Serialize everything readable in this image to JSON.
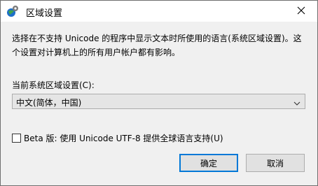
{
  "window": {
    "title": "区域设置",
    "icon": "globe-gear-icon",
    "close_icon": "close-icon"
  },
  "content": {
    "description": "选择在不支持 Unicode 的程序中显示文本时所使用的语言(系统区域设置)。这个设置对计算机上的所有用户帐户都有影响。",
    "select_label": "当前系统区域设置(C):",
    "select_value": "中文(简体，中国)",
    "checkbox_label": "Beta 版: 使用 Unicode UTF-8 提供全球语言支持(U)",
    "checkbox_checked": false
  },
  "buttons": {
    "ok": "确定",
    "cancel": "取消"
  },
  "colors": {
    "accent": "#0078d7",
    "dialog_bg": "#f0f0f0"
  }
}
